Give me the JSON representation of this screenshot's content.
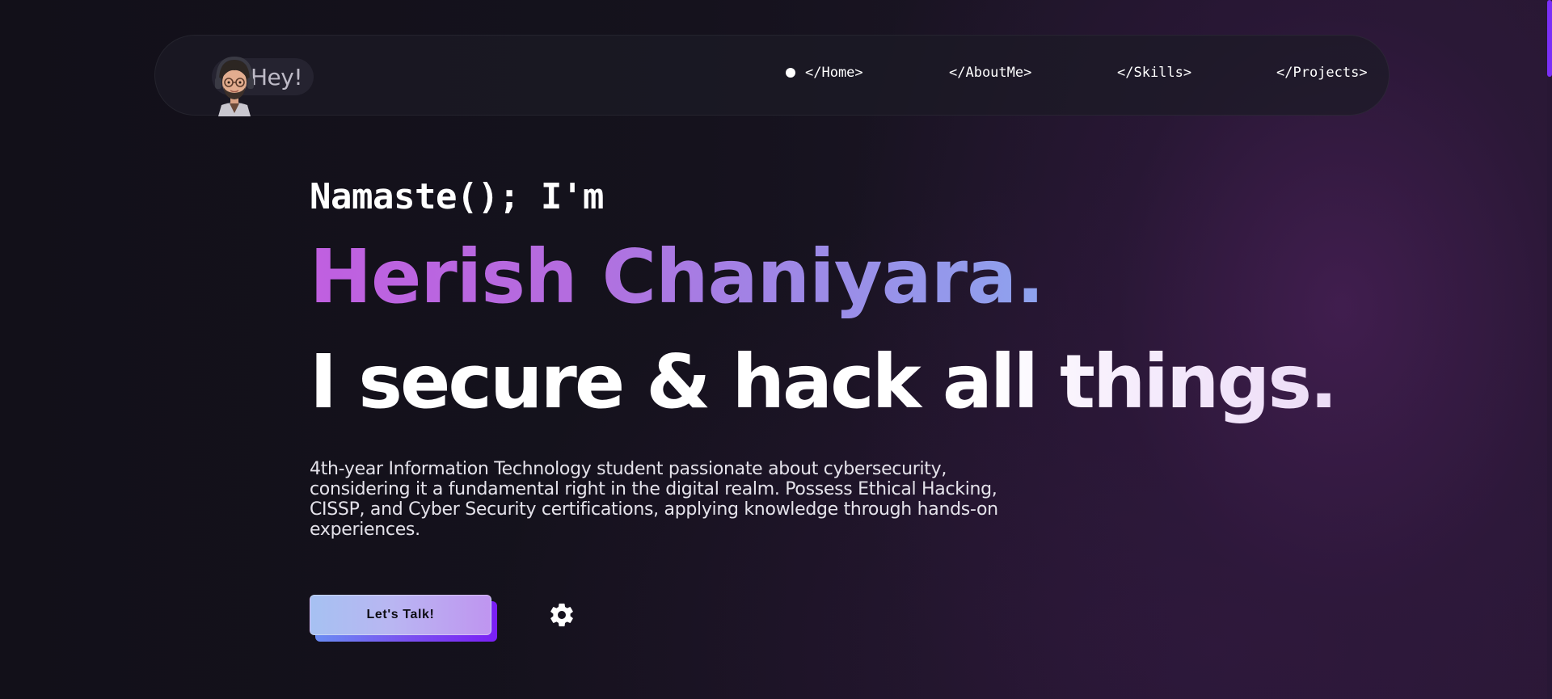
{
  "navbar": {
    "brand_label": "Hey!",
    "links": [
      {
        "label": "</Home>",
        "active": true
      },
      {
        "label": "</AboutMe>",
        "active": false
      },
      {
        "label": "</Skills>",
        "active": false
      },
      {
        "label": "</Projects>",
        "active": false
      }
    ]
  },
  "hero": {
    "greeting": "Namaste(); I'm",
    "name": "Herish Chaniyara.",
    "tagline": "I secure & hack all things.",
    "bio": "4th-year Information Technology student passionate about cybersecurity, considering it a fundamental right in the digital realm. Possess Ethical Hacking, CISSP, and Cyber Security certifications, applying knowledge through hands-on experiences.",
    "cta_label": "Let's Talk!"
  },
  "icons": {
    "settings": "gear-icon",
    "avatar": "memoji-avatar"
  },
  "colors": {
    "accent_purple": "#7b2ff7",
    "name_gradient_start": "#c05fe0",
    "name_gradient_end": "#8ea3ee",
    "background": "#121019"
  }
}
